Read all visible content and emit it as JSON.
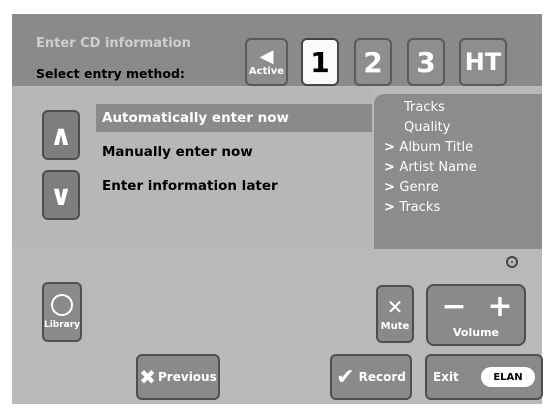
{
  "header": {
    "title": "Enter CD information",
    "subtitle": "Select entry method:"
  },
  "zones": {
    "active_label": "Active",
    "zone1": "1",
    "zone2": "2",
    "zone3": "3",
    "ht": "HT"
  },
  "options": {
    "auto": "Automatically enter now",
    "manual": "Manually enter now",
    "later": "Enter information later"
  },
  "info": {
    "lines": [
      "Tracks",
      "Quality",
      "Album Title",
      "Artist Name",
      "Genre",
      "Tracks"
    ]
  },
  "controls": {
    "library": "Library",
    "mute": "Mute",
    "volume": "Volume",
    "previous": "Previous",
    "record": "Record",
    "exit": "Exit",
    "brand": "ELAN"
  }
}
